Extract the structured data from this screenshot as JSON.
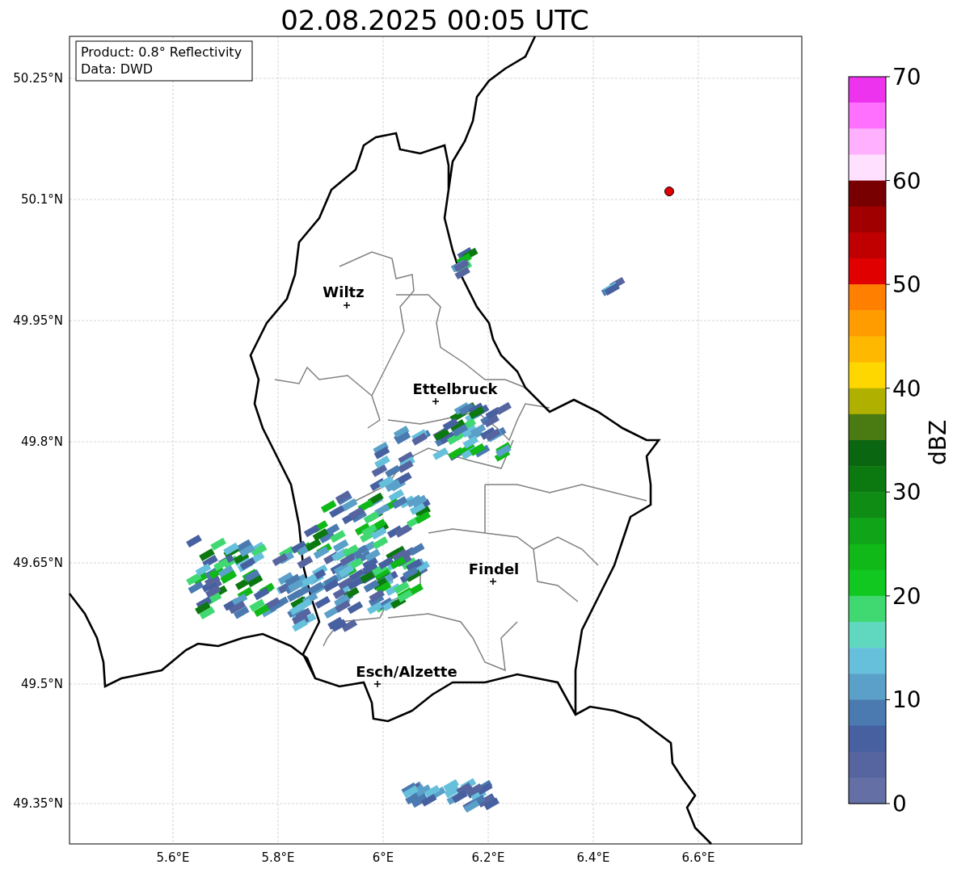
{
  "title": "02.08.2025 00:05 UTC",
  "info_box": [
    "Product: 0.8° Reflectivity",
    "Data: DWD"
  ],
  "map": {
    "cities": [
      {
        "name": "Wiltz"
      },
      {
        "name": "Ettelbruck"
      },
      {
        "name": "Findel"
      },
      {
        "name": "Esch/Alzette"
      }
    ],
    "lat_labels": [
      "50.25°N",
      "50.1°N",
      "49.95°N",
      "49.8°N",
      "49.65°N",
      "49.5°N",
      "49.35°N"
    ],
    "lon_labels": [
      "5.6°E",
      "5.8°E",
      "6°E",
      "6.2°E",
      "6.4°E",
      "6.6°E"
    ]
  },
  "colorbar": {
    "label": "dBZ",
    "ticks": [
      "70",
      "60",
      "50",
      "40",
      "30",
      "20",
      "10",
      "0"
    ],
    "bands": [
      {
        "color": "#ee33ee"
      },
      {
        "color": "#ff70ff"
      },
      {
        "color": "#ffb0ff"
      },
      {
        "color": "#ffe0ff"
      },
      {
        "color": "#780000"
      },
      {
        "color": "#a00000"
      },
      {
        "color": "#c00000"
      },
      {
        "color": "#e00000"
      },
      {
        "color": "#ff7f00"
      },
      {
        "color": "#ff9c00"
      },
      {
        "color": "#ffb800"
      },
      {
        "color": "#ffd700"
      },
      {
        "color": "#b0b000"
      },
      {
        "color": "#4a7a12"
      },
      {
        "color": "#0a6610"
      },
      {
        "color": "#0c7810"
      },
      {
        "color": "#0e8c14"
      },
      {
        "color": "#10a418"
      },
      {
        "color": "#10b818"
      },
      {
        "color": "#10c820"
      },
      {
        "color": "#40d870"
      },
      {
        "color": "#60d8c0"
      },
      {
        "color": "#66c0dc"
      },
      {
        "color": "#5aa0c8"
      },
      {
        "color": "#4a7ab0"
      },
      {
        "color": "#4660a0"
      },
      {
        "color": "#56659f"
      },
      {
        "color": "#6470a5"
      }
    ]
  }
}
